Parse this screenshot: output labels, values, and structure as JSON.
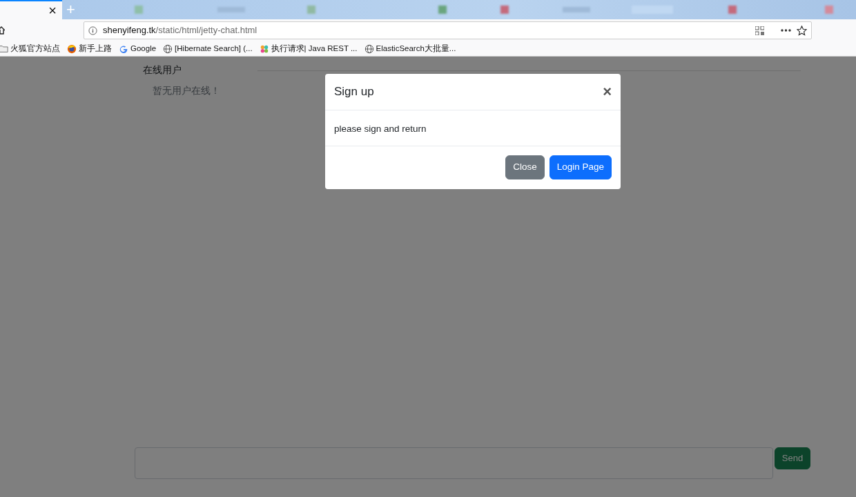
{
  "browser": {
    "active_tab": {
      "close": "×"
    },
    "new_tab": "+",
    "url_host": "shenyifeng.tk",
    "url_path": "/static/html/jetty-chat.html",
    "bookmarks": [
      {
        "kind": "folder",
        "label": "火狐官方站点"
      },
      {
        "kind": "firefox",
        "label": "新手上路"
      },
      {
        "kind": "google",
        "label": "Google"
      },
      {
        "kind": "globe",
        "label": "[Hibernate Search] (..."
      },
      {
        "kind": "flower",
        "label": "执行请求| Java REST ..."
      },
      {
        "kind": "globe",
        "label": "ElasticSearch大批量..."
      }
    ]
  },
  "sidebar": {
    "title": "在线用户",
    "empty_text": "暂无用户在线！"
  },
  "chat": {
    "send_button": "Send"
  },
  "modal": {
    "title": "Sign up",
    "close": "×",
    "body": "please sign and return",
    "buttons": [
      {
        "kind": "secondary",
        "label": "Close"
      },
      {
        "kind": "primary",
        "label": "Login Page"
      }
    ]
  }
}
